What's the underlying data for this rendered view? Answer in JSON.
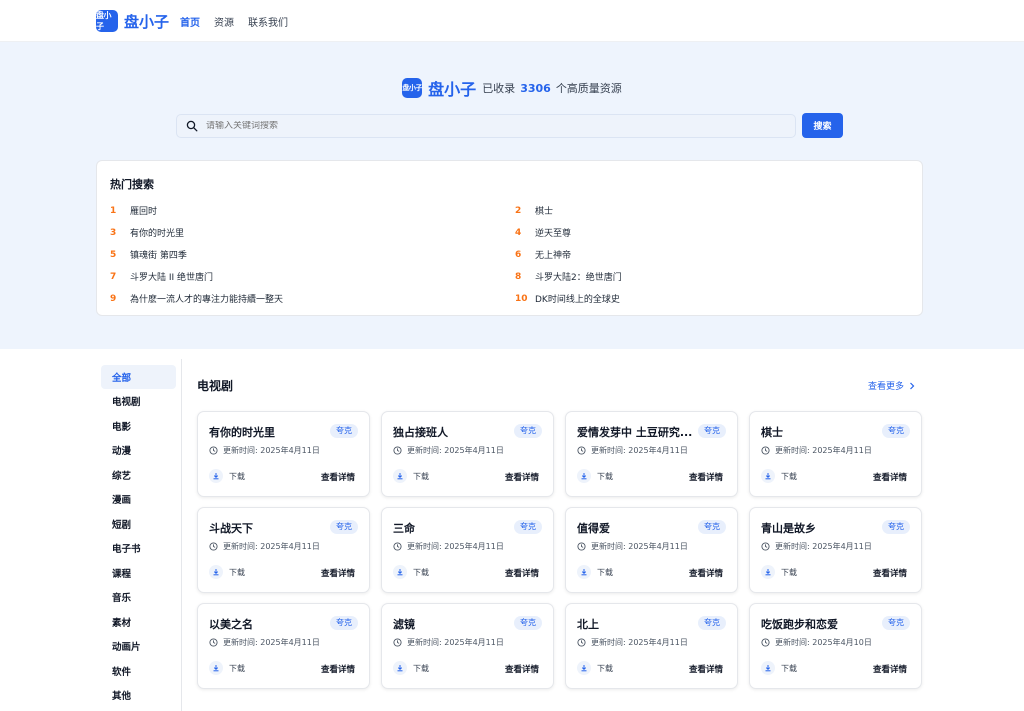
{
  "header": {
    "logo_text": "盘小子",
    "brand": "盘小子",
    "nav": [
      "首页",
      "资源",
      "联系我们"
    ]
  },
  "hero": {
    "logo_text": "盘小子",
    "brand": "盘小子",
    "prefix": "已收录",
    "count": "3306",
    "suffix": "个高质量资源",
    "search_placeholder": "请输入关键词搜索",
    "search_button": "搜索"
  },
  "hot": {
    "title": "热门搜索",
    "items": [
      {
        "num": "1",
        "text": "雁回时"
      },
      {
        "num": "2",
        "text": "棋士"
      },
      {
        "num": "3",
        "text": "有你的时光里"
      },
      {
        "num": "4",
        "text": "逆天至尊"
      },
      {
        "num": "5",
        "text": "镇魂街 第四季"
      },
      {
        "num": "6",
        "text": "无上神帝"
      },
      {
        "num": "7",
        "text": "斗罗大陆 II 绝世唐门"
      },
      {
        "num": "8",
        "text": "斗罗大陆2：绝世唐门"
      },
      {
        "num": "9",
        "text": "為什麽一流人才的專注力能持續一整天"
      },
      {
        "num": "10",
        "text": "DK时间线上的全球史"
      }
    ]
  },
  "sidebar": {
    "items": [
      "全部",
      "电视剧",
      "电影",
      "动漫",
      "综艺",
      "漫画",
      "短剧",
      "电子书",
      "课程",
      "音乐",
      "素材",
      "动画片",
      "软件",
      "其他"
    ]
  },
  "section": {
    "title": "电视剧",
    "more": "查看更多"
  },
  "cards": [
    {
      "title": "有你的时光里",
      "tag": "夸克",
      "time": "更新时间: 2025年4月11日",
      "download": "下载",
      "detail": "查看详情"
    },
    {
      "title": "独占接班人",
      "tag": "夸克",
      "time": "更新时间: 2025年4月11日",
      "download": "下载",
      "detail": "查看详情"
    },
    {
      "title": "爱情发芽中 土豆研究...",
      "tag": "夸克",
      "time": "更新时间: 2025年4月11日",
      "download": "下载",
      "detail": "查看详情"
    },
    {
      "title": "棋士",
      "tag": "夸克",
      "time": "更新时间: 2025年4月11日",
      "download": "下载",
      "detail": "查看详情"
    },
    {
      "title": "斗战天下",
      "tag": "夸克",
      "time": "更新时间: 2025年4月11日",
      "download": "下载",
      "detail": "查看详情"
    },
    {
      "title": "三命",
      "tag": "夸克",
      "time": "更新时间: 2025年4月11日",
      "download": "下载",
      "detail": "查看详情"
    },
    {
      "title": "值得爱",
      "tag": "夸克",
      "time": "更新时间: 2025年4月11日",
      "download": "下载",
      "detail": "查看详情"
    },
    {
      "title": "青山是故乡",
      "tag": "夸克",
      "time": "更新时间: 2025年4月11日",
      "download": "下载",
      "detail": "查看详情"
    },
    {
      "title": "以美之名",
      "tag": "夸克",
      "time": "更新时间: 2025年4月11日",
      "download": "下载",
      "detail": "查看详情"
    },
    {
      "title": "滤镜",
      "tag": "夸克",
      "time": "更新时间: 2025年4月11日",
      "download": "下载",
      "detail": "查看详情"
    },
    {
      "title": "北上",
      "tag": "夸克",
      "time": "更新时间: 2025年4月11日",
      "download": "下载",
      "detail": "查看详情"
    },
    {
      "title": "吃饭跑步和恋爱",
      "tag": "夸克",
      "time": "更新时间: 2025年4月10日",
      "download": "下载",
      "detail": "查看详情"
    }
  ],
  "colors": {
    "accent": "#2563eb",
    "hot_number": "#f97316",
    "hero_bg": "#eef4fd"
  },
  "icons": [
    "search-icon",
    "clock-icon",
    "download-icon",
    "chevron-right-icon"
  ]
}
